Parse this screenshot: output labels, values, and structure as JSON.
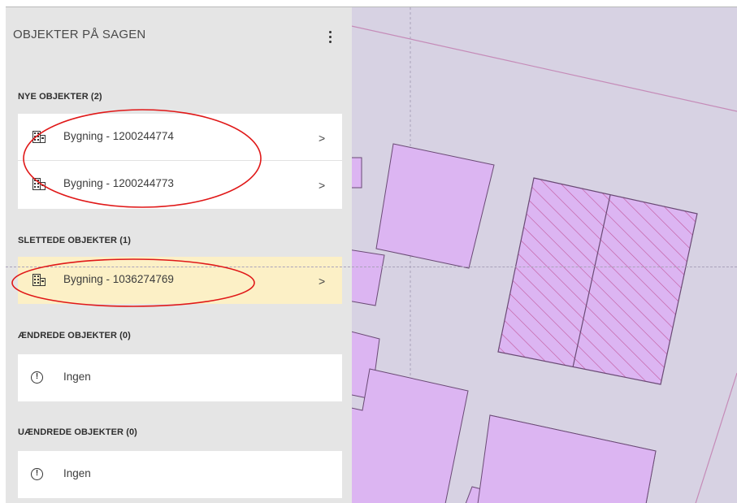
{
  "panel": {
    "title": "OBJEKTER PÅ SAGEN",
    "menu_icon": "kebab-menu-icon"
  },
  "sections": {
    "new": {
      "heading": "NYE OBJEKTER (2)",
      "items": [
        {
          "label": "Bygning - 1200244774",
          "icon": "building-icon"
        },
        {
          "label": "Bygning - 1200244773",
          "icon": "building-icon"
        }
      ]
    },
    "deleted": {
      "heading": "SLETTEDE OBJEKTER (1)",
      "items": [
        {
          "label": "Bygning - 1036274769",
          "icon": "building-icon",
          "highlighted": true
        }
      ]
    },
    "changed": {
      "heading": "ÆNDREDE OBJEKTER (0)",
      "empty_label": "Ingen"
    },
    "unchanged": {
      "heading": "UÆNDREDE OBJEKTER (0)",
      "empty_label": "Ingen"
    }
  },
  "colors": {
    "panel_bg": "#e5e5e5",
    "highlight_bg": "#fcf0c6",
    "map_bg": "#d7d2e3",
    "building_fill": "#dcb5f2",
    "building_stroke": "#6a4a75",
    "hatch_stroke": "#c0559a",
    "annotation_ellipse": "#e01818"
  }
}
